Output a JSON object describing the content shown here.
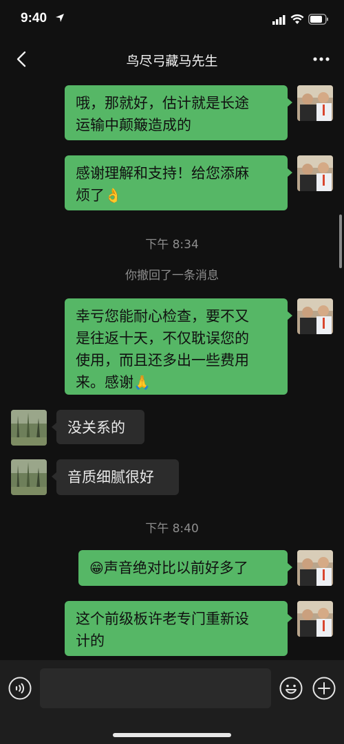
{
  "status_bar": {
    "time": "9:40"
  },
  "header": {
    "title": "鸟尽弓藏马先生"
  },
  "messages": [
    {
      "side": "out",
      "lines": [
        "哦，那就好，估计就是长途",
        "运输中颠簸造成的"
      ]
    },
    {
      "side": "out",
      "lines": [
        "感谢理解和支持！给您添麻",
        "烦了"
      ],
      "emoji": "👌"
    },
    {
      "system_time": "下午 8:34"
    },
    {
      "system_note": "你撤回了一条消息"
    },
    {
      "side": "out",
      "lines": [
        "幸亏您能耐心检查，要不又",
        "是往返十天，不仅耽误您的",
        "使用，而且还多出一些费用",
        "来。感谢"
      ],
      "emoji": "🙏"
    },
    {
      "side": "in",
      "lines": [
        "没关系的"
      ]
    },
    {
      "side": "in",
      "lines": [
        "音质细腻很好"
      ]
    },
    {
      "system_time": "下午 8:40"
    },
    {
      "side": "out",
      "lines": [
        "声音绝对比以前好多了"
      ],
      "emoji": "😁"
    },
    {
      "side": "out",
      "lines": [
        "这个前级板许老专门重新设",
        "计的"
      ]
    }
  ],
  "input": {
    "placeholder": ""
  },
  "icons": {
    "back": "chevron-left-icon",
    "more": "more-dots-icon",
    "voice": "voice-icon",
    "emoji": "smiley-icon",
    "plus": "plus-icon"
  },
  "colors": {
    "outgoing_bubble": "#56b766",
    "incoming_bubble": "#2c2c2c",
    "background": "#111111"
  }
}
